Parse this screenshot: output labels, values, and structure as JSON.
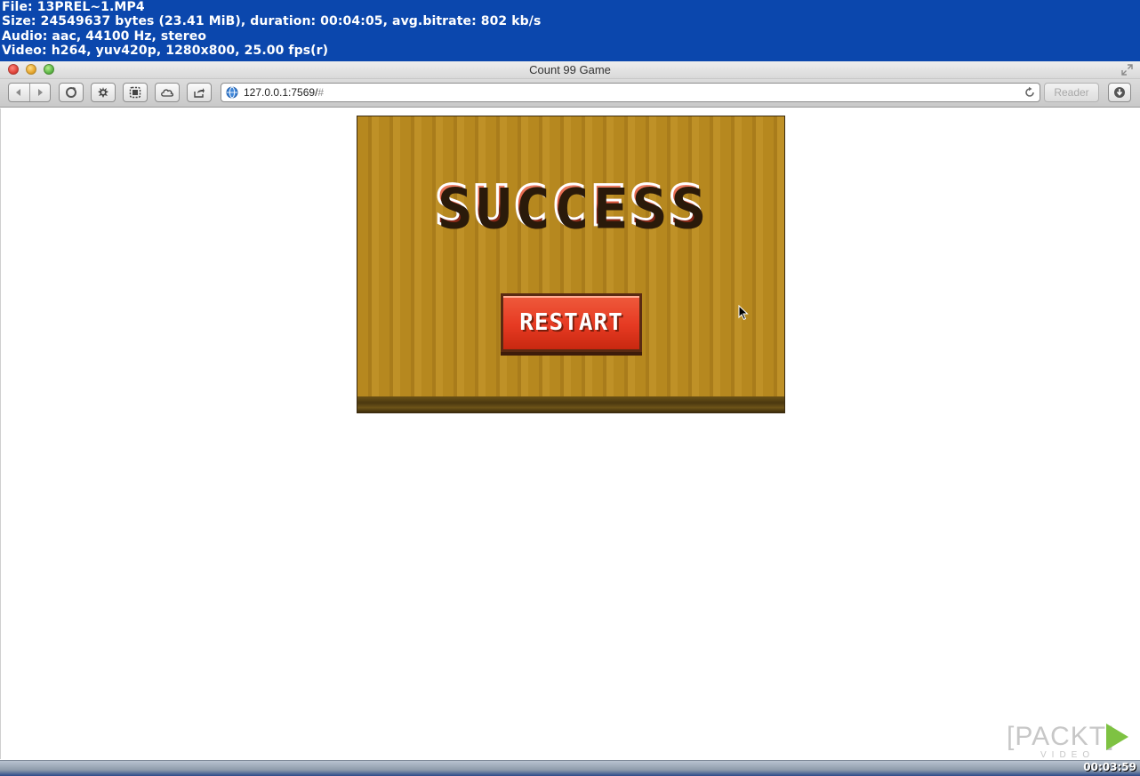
{
  "overlay": {
    "line1": "File: 13PREL~1.MP4",
    "line2": "Size: 24549637 bytes (23.41 MiB), duration: 00:04:05, avg.bitrate: 802 kb/s",
    "line3": "Audio: aac, 44100 Hz, stereo",
    "line4": "Video: h264, yuv420p, 1280x800, 25.00 fps(r)"
  },
  "window": {
    "title": "Count 99 Game"
  },
  "toolbar": {
    "url": "127.0.0.1:7569/",
    "url_hash": "#",
    "reader_label": "Reader"
  },
  "game": {
    "success_text": "SUCCESS",
    "restart_label": "RESTART"
  },
  "watermark": {
    "brand": "[PACKT]",
    "sub": "VIDEO"
  },
  "player": {
    "time_code": "00:03:59"
  },
  "colors": {
    "overlay_bg": "#0b47ad",
    "game_bg": "#b78a22",
    "restart_bg": "#e63a22"
  }
}
